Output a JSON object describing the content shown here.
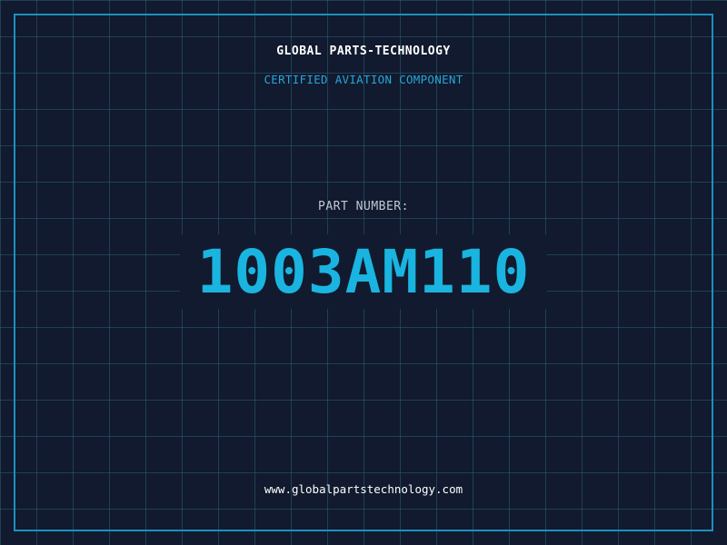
{
  "header": {
    "company_name": "GLOBAL PARTS-TECHNOLOGY",
    "tagline": "CERTIFIED AVIATION COMPONENT"
  },
  "part": {
    "label": "PART NUMBER:",
    "number": "1003AM110"
  },
  "footer": {
    "website": "www.globalpartstechnology.com"
  },
  "colors": {
    "background": "#111a2e",
    "grid": "#2a5e78",
    "frame": "#1e8fc0",
    "accent": "#1ab4e0",
    "text": "#ffffff",
    "muted_text": "#c0c8d4"
  }
}
